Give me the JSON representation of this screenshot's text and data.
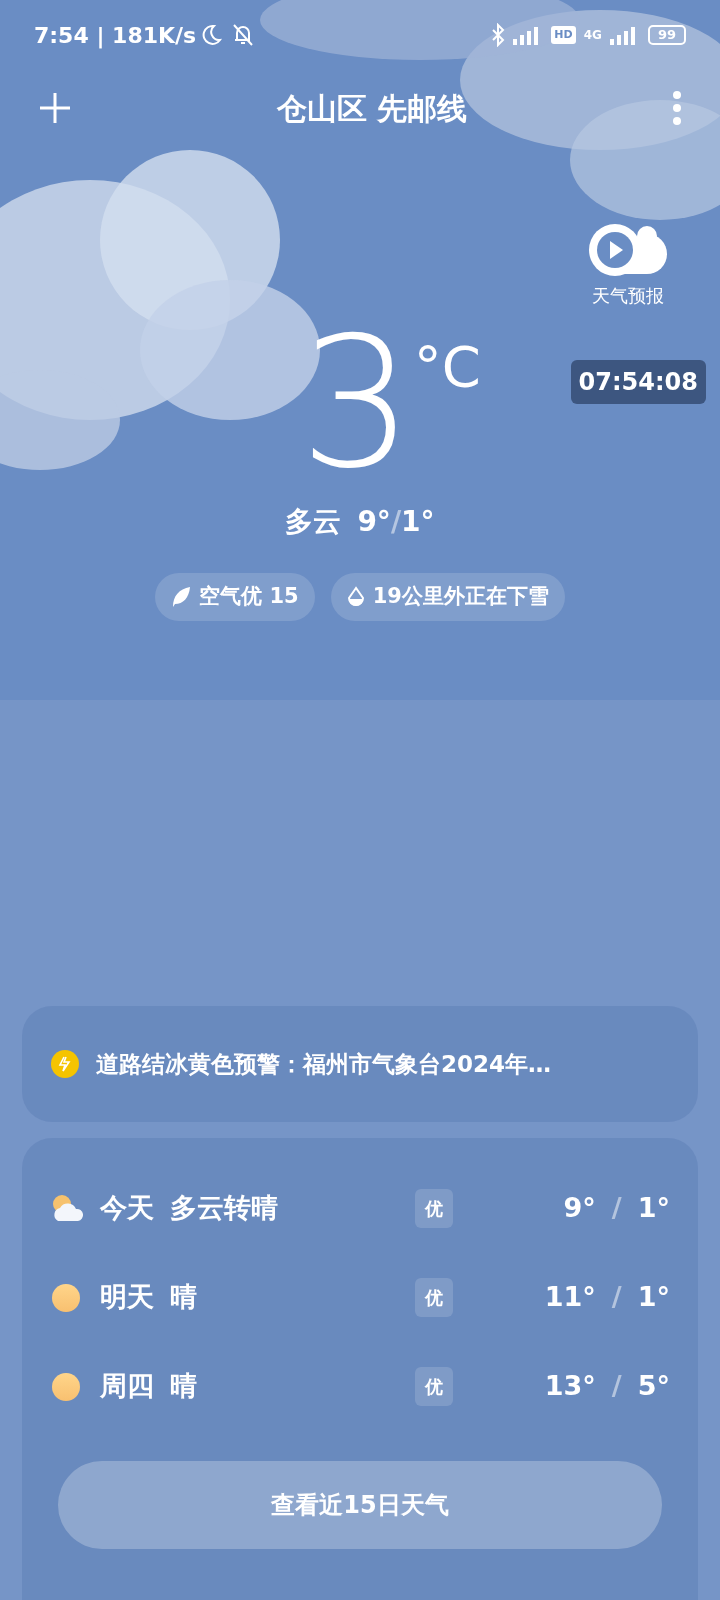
{
  "status_bar": {
    "time_speed": "7:54 | 181K/s",
    "hd": "HD",
    "network": "4G",
    "battery": "99"
  },
  "header": {
    "location": "仓山区 先邮线"
  },
  "video_forecast": {
    "label": "天气预报"
  },
  "recorder_timer": "07:54:08",
  "current": {
    "temperature": "3",
    "unit": "°C",
    "condition": "多云",
    "high": "9°",
    "separator": "/",
    "low": "1°"
  },
  "chips": [
    {
      "kind": "air",
      "text": "空气优 15"
    },
    {
      "kind": "rain",
      "text": "19公里外正在下雪"
    }
  ],
  "alert": {
    "color": "#f5c400",
    "text": "道路结冰黄色预警：福州市气象台2024年…"
  },
  "forecast": [
    {
      "kind": "partly-cloudy",
      "day": "今天",
      "condition": "多云转晴",
      "aqi": "优",
      "high": "9°",
      "separator": "/",
      "low": "1°"
    },
    {
      "kind": "sunny",
      "day": "明天",
      "condition": "晴",
      "aqi": "优",
      "high": "11°",
      "separator": "/",
      "low": "1°"
    },
    {
      "kind": "sunny",
      "day": "周四",
      "condition": "晴",
      "aqi": "优",
      "high": "13°",
      "separator": "/",
      "low": "5°"
    }
  ],
  "more_button": "查看近15日天气"
}
